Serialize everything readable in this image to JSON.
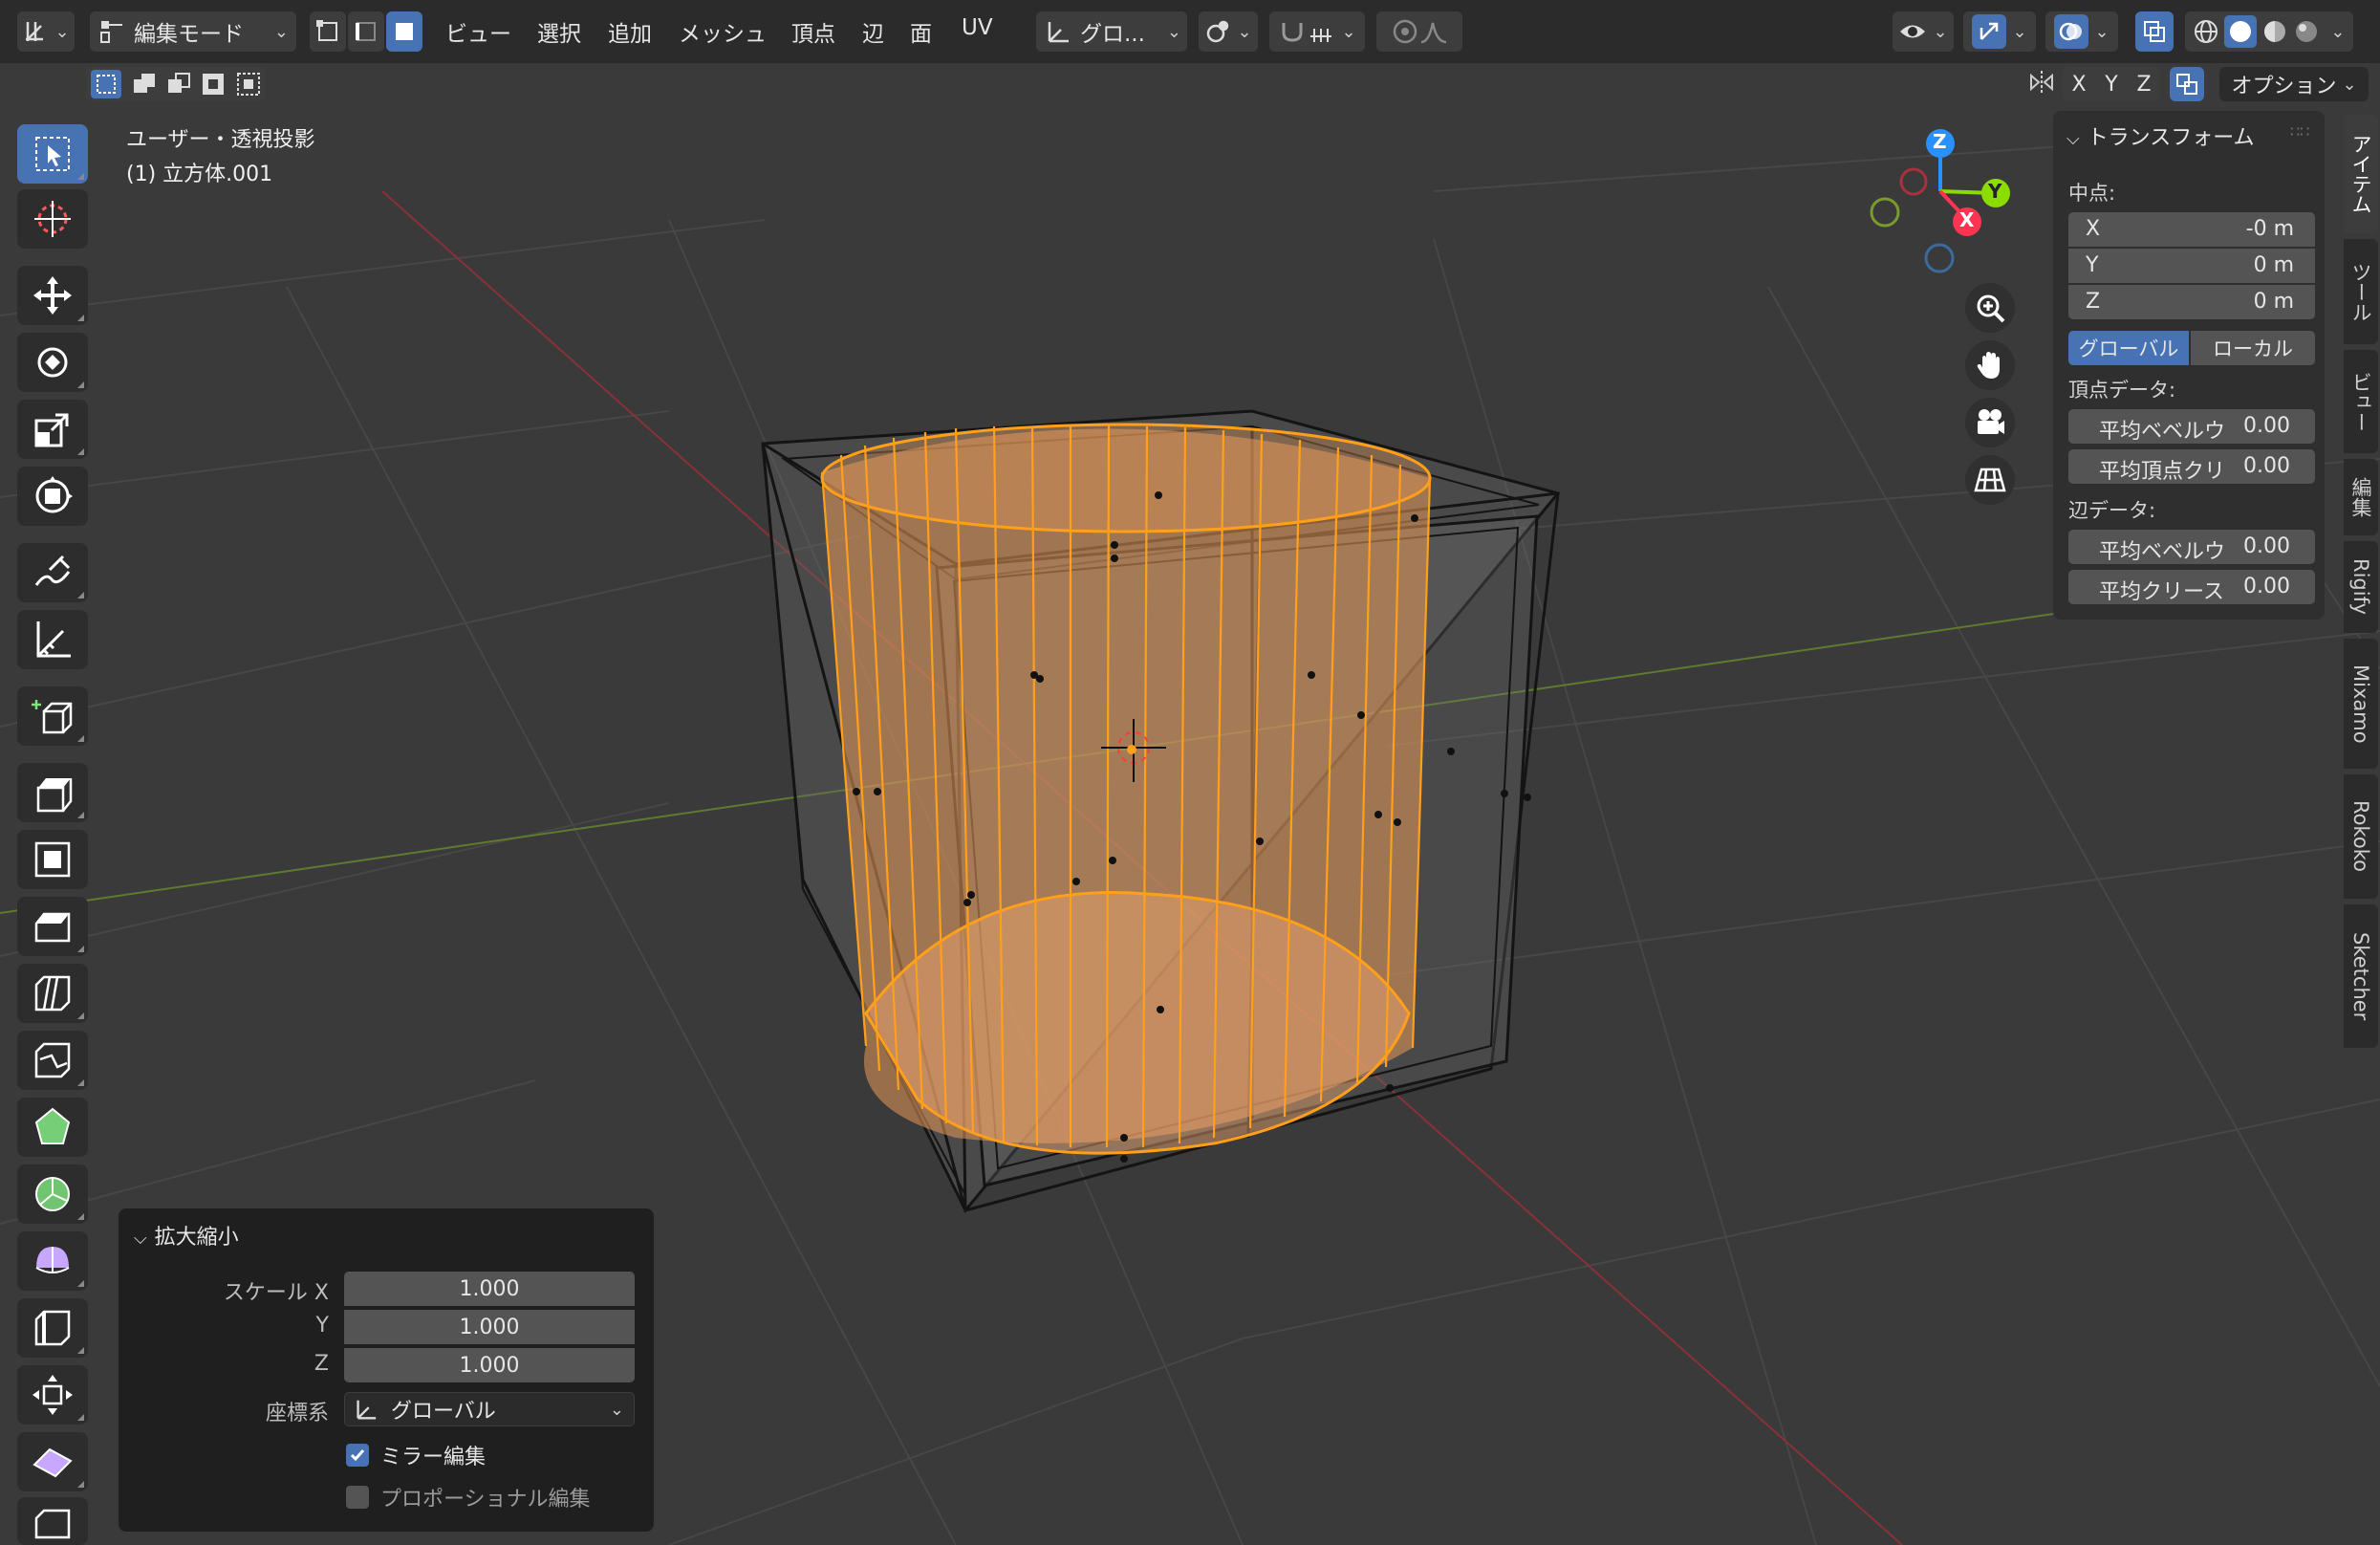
{
  "header": {
    "editor_type_icon": "grid-axes-icon",
    "mode_label": "編集モード",
    "menus": [
      "ビュー",
      "選択",
      "追加",
      "メッシュ",
      "頂点",
      "辺",
      "面",
      "UV"
    ],
    "transform_orientation": "グロ...",
    "options_label": "オプション",
    "axis_x": "X",
    "axis_y": "Y",
    "axis_z": "Z"
  },
  "viewport": {
    "view_name": "ユーザー・透視投影",
    "object_name": "(1) 立方体.001"
  },
  "gizmo": {
    "x": "X",
    "y": "Y",
    "z": "Z"
  },
  "npanel": {
    "section_title": "トランスフォーム",
    "median_label": "中点:",
    "x_label": "X",
    "x_value": "-0 m",
    "y_label": "Y",
    "y_value": "0 m",
    "z_label": "Z",
    "z_value": "0 m",
    "global_label": "グローバル",
    "local_label": "ローカル",
    "vertex_data_label": "頂点データ:",
    "vertex_bevel_label": "平均ベベルウ",
    "vertex_bevel_value": "0.00",
    "vertex_crease_label": "平均頂点クリ",
    "vertex_crease_value": "0.00",
    "edge_data_label": "辺データ:",
    "edge_bevel_label": "平均ベベルウ",
    "edge_bevel_value": "0.00",
    "edge_crease_label": "平均クリース",
    "edge_crease_value": "0.00"
  },
  "vtabs": [
    "アイテム",
    "ツール",
    "ビュー",
    "編集",
    "Rigify",
    "Mixamo",
    "Rokoko",
    "Sketcher"
  ],
  "operator": {
    "title": "拡大縮小",
    "scale_x_label": "スケール X",
    "scale_x": "1.000",
    "scale_y_label": "Y",
    "scale_y": "1.000",
    "scale_z_label": "Z",
    "scale_z": "1.000",
    "orient_label": "座標系",
    "orient_value": "グローバル",
    "mirror_label": "ミラー編集",
    "mirror_checked": true,
    "proportional_label": "プロポーショナル編集",
    "proportional_checked": false
  },
  "colors": {
    "accent": "#4772b3",
    "selection": "#ff9f1a",
    "axis_x": "#ff3352",
    "axis_y": "#8bdc00",
    "axis_z": "#2890ff"
  }
}
